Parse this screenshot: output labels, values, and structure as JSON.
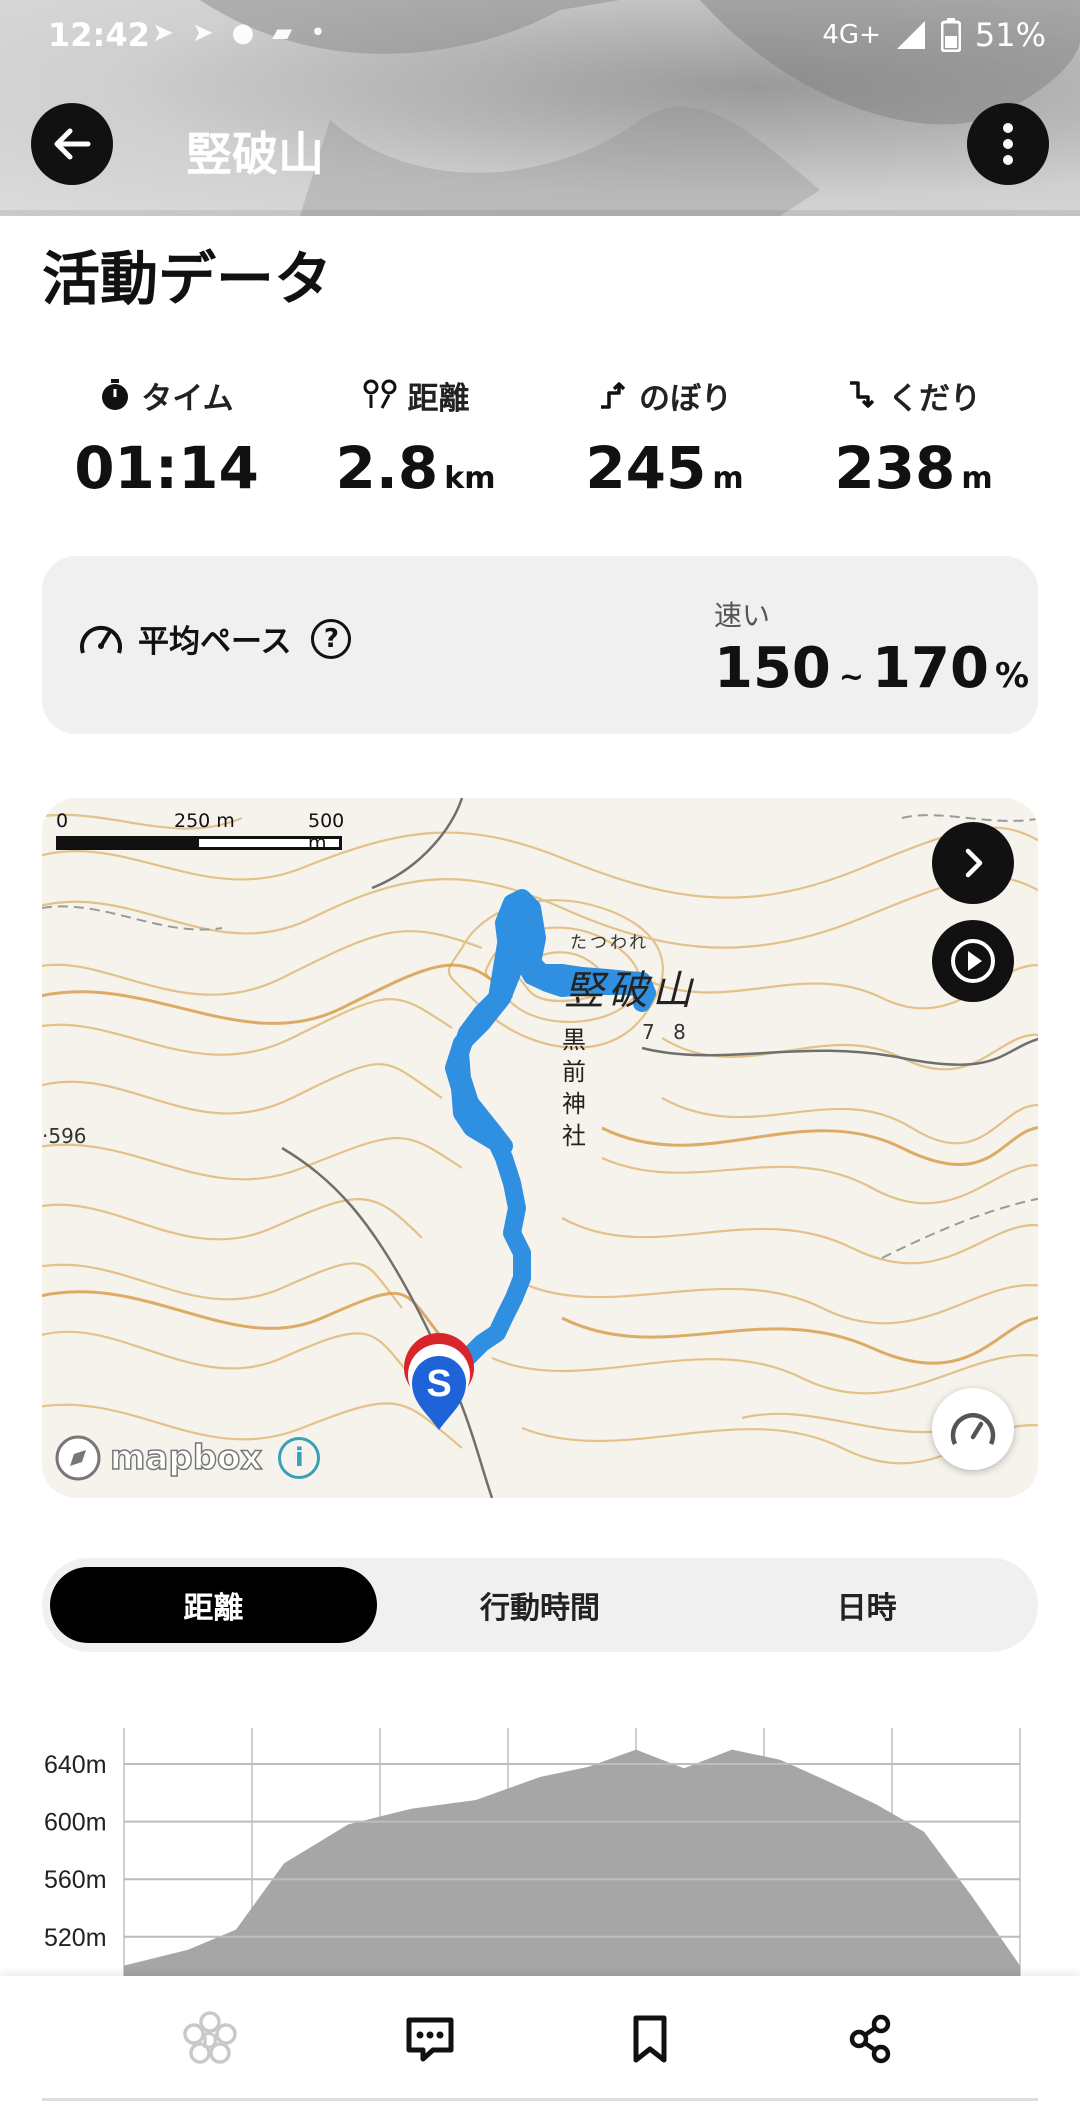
{
  "status_bar": {
    "time": "12:42",
    "network": "4G+",
    "battery": "51%"
  },
  "header": {
    "title": "竪破山"
  },
  "section_title": "活動データ",
  "stats": [
    {
      "label": "タイム",
      "value": "01:14",
      "unit": ""
    },
    {
      "label": "距離",
      "value": "2.8",
      "unit": "km"
    },
    {
      "label": "のぼり",
      "value": "245",
      "unit": "m"
    },
    {
      "label": "くだり",
      "value": "238",
      "unit": "m"
    }
  ],
  "pace": {
    "label": "平均ペース",
    "category": "速い",
    "low": "150",
    "tilde": "~",
    "high": "170",
    "unit": "%"
  },
  "map": {
    "scale_labels": [
      "0",
      "250 m",
      "500 m"
    ],
    "place_name": "竪破山",
    "place_ruby": "たつわれ",
    "elevation_label": "7 8",
    "shrine_label": "黒前神社",
    "spot_height": "·596",
    "logo_text": "mapbox",
    "info_glyph": "i",
    "start_marker": "S",
    "route_color": "#2f8fe0"
  },
  "tabs": [
    {
      "label": "距離",
      "active": true
    },
    {
      "label": "行動時間",
      "active": false
    },
    {
      "label": "日時",
      "active": false
    }
  ],
  "chart_data": {
    "type": "area",
    "title": "",
    "ylabel": "",
    "ylim": [
      490,
      665
    ],
    "yticks": [
      "640m",
      "600m",
      "560m",
      "520m"
    ],
    "x": [
      0.0,
      0.2,
      0.35,
      0.5,
      0.7,
      0.9,
      1.1,
      1.3,
      1.45,
      1.6,
      1.75,
      1.9,
      2.05,
      2.2,
      2.35,
      2.5,
      2.65,
      2.8
    ],
    "values": [
      500,
      511,
      525,
      571,
      598,
      609,
      615,
      631,
      638,
      650,
      637,
      650,
      643,
      628,
      612,
      593,
      548,
      500
    ]
  },
  "bottom_nav": [
    "domo-icon",
    "comment-icon",
    "bookmark-icon",
    "share-icon"
  ]
}
